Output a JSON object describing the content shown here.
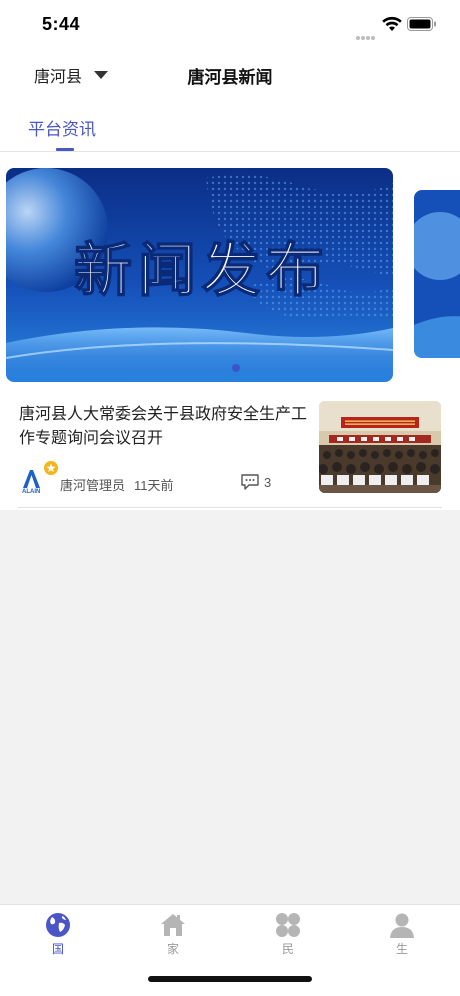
{
  "status": {
    "time": "5:44"
  },
  "header": {
    "region": "唐河县",
    "title": "唐河县新闻"
  },
  "tabs": [
    {
      "label": "平台资讯"
    }
  ],
  "banner": {
    "title": "新闻发布",
    "active_index": 0
  },
  "news": [
    {
      "title": "唐河县人大常委会关于县政府安全生产工作专题询问会议召开",
      "author": "唐河管理员",
      "time_ago": "11天前",
      "comments": "3"
    }
  ],
  "bottom_nav": [
    {
      "label": "国",
      "icon": "globe-icon",
      "active": true
    },
    {
      "label": "家",
      "icon": "house-icon",
      "active": false
    },
    {
      "label": "民",
      "icon": "clover-icon",
      "active": false
    },
    {
      "label": "生",
      "icon": "person-icon",
      "active": false
    }
  ],
  "colors": {
    "accent": "#4a56c8",
    "background": "#f2f2f2",
    "inactive": "#9a9a9a"
  }
}
